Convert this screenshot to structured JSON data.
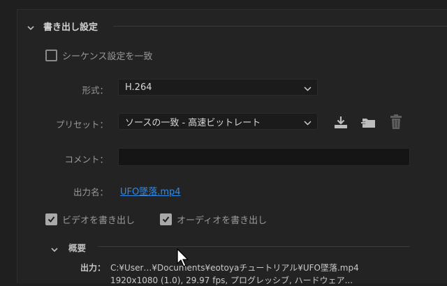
{
  "section": {
    "title": "書き出し設定"
  },
  "match_sequence": {
    "label": "シーケンス設定を一致",
    "checked": false
  },
  "format": {
    "label": "形式：",
    "value": "H.264"
  },
  "preset": {
    "label": "プリセット：",
    "value": "ソースの一致 - 高速ビットレート"
  },
  "comment": {
    "label": "コメント：",
    "value": ""
  },
  "output_name": {
    "label": "出力名：",
    "value": "UFO墜落.mp4"
  },
  "export_video": {
    "label": "ビデオを書き出し",
    "checked": true
  },
  "export_audio": {
    "label": "オーディオを書き出し",
    "checked": true
  },
  "summary": {
    "title": "概要",
    "output_label": "出力：",
    "lines": [
      "C:¥User…¥Documents¥eotoyaチュートリアル¥UFO墜落.mp4",
      "1920x1080 (1.0), 29.97 fps, プログレッシブ, ハードウェア..."
    ]
  },
  "icons": [
    "chevron-down-icon",
    "save-preset-icon",
    "import-preset-icon",
    "trash-icon",
    "cursor-icon"
  ]
}
